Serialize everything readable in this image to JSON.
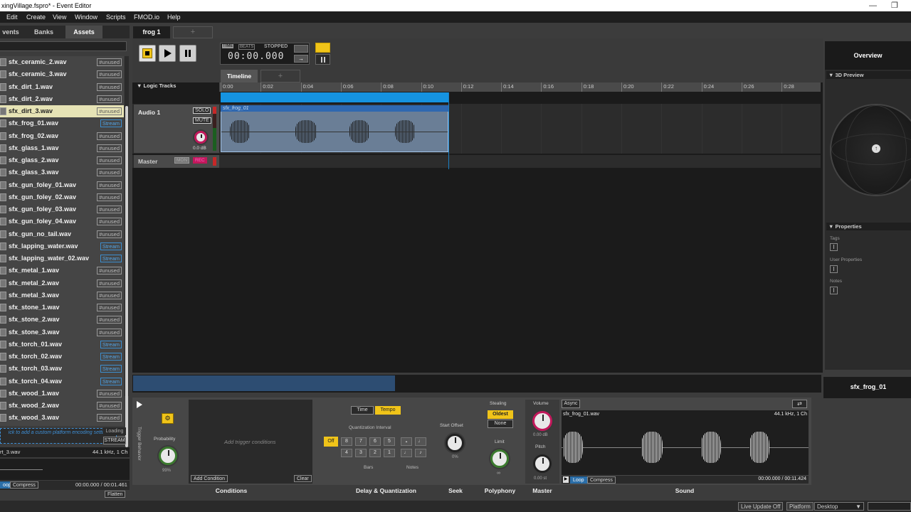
{
  "window": {
    "title": "xingVillage.fspro* - Event Editor"
  },
  "menu": [
    "Edit",
    "Create",
    "View",
    "Window",
    "Scripts",
    "FMOD.io",
    "Help"
  ],
  "left_panel": {
    "tabs": [
      "vents",
      "Banks",
      "Assets"
    ],
    "active_tab": "Assets",
    "files": [
      {
        "name": "sfx_ceramic_2.wav",
        "tag": "#unused"
      },
      {
        "name": "sfx_ceramic_3.wav",
        "tag": "#unused"
      },
      {
        "name": "sfx_dirt_1.wav",
        "tag": "#unused"
      },
      {
        "name": "sfx_dirt_2.wav",
        "tag": "#unused"
      },
      {
        "name": "sfx_dirt_3.wav",
        "tag": "#unused",
        "selected": true
      },
      {
        "name": "sfx_frog_01.wav",
        "tag": "Stream"
      },
      {
        "name": "sfx_frog_02.wav",
        "tag": "#unused"
      },
      {
        "name": "sfx_glass_1.wav",
        "tag": "#unused"
      },
      {
        "name": "sfx_glass_2.wav",
        "tag": "#unused"
      },
      {
        "name": "sfx_glass_3.wav",
        "tag": "#unused"
      },
      {
        "name": "sfx_gun_foley_01.wav",
        "tag": "#unused"
      },
      {
        "name": "sfx_gun_foley_02.wav",
        "tag": "#unused"
      },
      {
        "name": "sfx_gun_foley_03.wav",
        "tag": "#unused"
      },
      {
        "name": "sfx_gun_foley_04.wav",
        "tag": "#unused"
      },
      {
        "name": "sfx_gun_no_tail.wav",
        "tag": "#unused"
      },
      {
        "name": "sfx_lapping_water.wav",
        "tag": "Stream"
      },
      {
        "name": "sfx_lapping_water_02.wav",
        "tag": "Stream"
      },
      {
        "name": "sfx_metal_1.wav",
        "tag": "#unused"
      },
      {
        "name": "sfx_metal_2.wav",
        "tag": "#unused"
      },
      {
        "name": "sfx_metal_3.wav",
        "tag": "#unused"
      },
      {
        "name": "sfx_stone_1.wav",
        "tag": "#unused"
      },
      {
        "name": "sfx_stone_2.wav",
        "tag": "#unused"
      },
      {
        "name": "sfx_stone_3.wav",
        "tag": "#unused"
      },
      {
        "name": "sfx_torch_01.wav",
        "tag": "Stream"
      },
      {
        "name": "sfx_torch_02.wav",
        "tag": "Stream"
      },
      {
        "name": "sfx_torch_03.wav",
        "tag": "Stream"
      },
      {
        "name": "sfx_torch_04.wav",
        "tag": "Stream"
      },
      {
        "name": "sfx_wood_1.wav",
        "tag": "#unused"
      },
      {
        "name": "sfx_wood_2.wav",
        "tag": "#unused"
      },
      {
        "name": "sfx_wood_3.wav",
        "tag": "#unused"
      }
    ],
    "platform_hint": "ick to add a custom platform encoding setting",
    "loading": "Loading",
    "stream_btn": "STREAM",
    "info_name": "rt_3.wav",
    "info_format": "44.1 kHz, 1 Ch",
    "loop": "oop",
    "compress": "Compress",
    "time": "00:00.000 / 00:01.461",
    "flatten": "Flatten"
  },
  "event": {
    "tab": "frog 1",
    "transport": {
      "time_label": "TIME",
      "beats_label": "BEATS",
      "state": "STOPPED",
      "time": "00:00.000"
    },
    "timeline_tab": "Timeline",
    "logic_tracks": "Logic Tracks",
    "ruler": [
      "0:00",
      "0:02",
      "0:04",
      "0:06",
      "0:08",
      "0:10",
      "0:12",
      "0:14",
      "0:16",
      "0:18",
      "0:20",
      "0:22",
      "0:24",
      "0:26",
      "0:28"
    ],
    "track": {
      "name": "Audio 1",
      "solo": "SOLO",
      "mute": "MUTE",
      "volume": "0.0 dB",
      "clip": "sfx_frog_01"
    },
    "master": {
      "name": "Master",
      "mon": "MON",
      "rec": "REC"
    }
  },
  "overview": {
    "title": "Overview",
    "preview_3d": "3D Preview",
    "properties": "Properties",
    "tags": "Tags",
    "user_props": "User Properties",
    "notes": "Notes",
    "selected_name": "sfx_frog_01"
  },
  "deck": {
    "trigger_label": "Trigger Behavior",
    "probability": "Probability",
    "probability_val": "99%",
    "conditions_hint": "Add trigger conditions",
    "add_condition": "Add Condition",
    "clear": "Clear",
    "time": "Time",
    "tempo": "Tempo",
    "quant_interval": "Quantization Interval",
    "off": "Off",
    "bars_nums": [
      "8",
      "7",
      "6",
      "5",
      "4",
      "3",
      "2",
      "1"
    ],
    "bars": "Bars",
    "notes": "Notes",
    "start_offset": "Start Offset",
    "start_offset_val": "0%",
    "stealing": "Stealing",
    "oldest": "Oldest",
    "none": "None",
    "limit": "Limit",
    "limit_val": "∞",
    "volume": "Volume",
    "volume_val": "0.00 dB",
    "pitch": "Pitch",
    "pitch_val": "0.00 st",
    "async": "Async",
    "sound_file": "sfx_frog_01.wav",
    "sound_format": "44.1 kHz, 1 Ch",
    "loop": "Loop",
    "compress": "Compress",
    "sound_time": "00:00.000 / 00:11.424",
    "labels": {
      "conditions": "Conditions",
      "delay": "Delay & Quantization",
      "seek": "Seek",
      "polyphony": "Polyphony",
      "master": "Master",
      "sound": "Sound"
    }
  },
  "status": {
    "live_update": "Live Update Off",
    "platform": "Platform",
    "desktop": "Desktop"
  }
}
